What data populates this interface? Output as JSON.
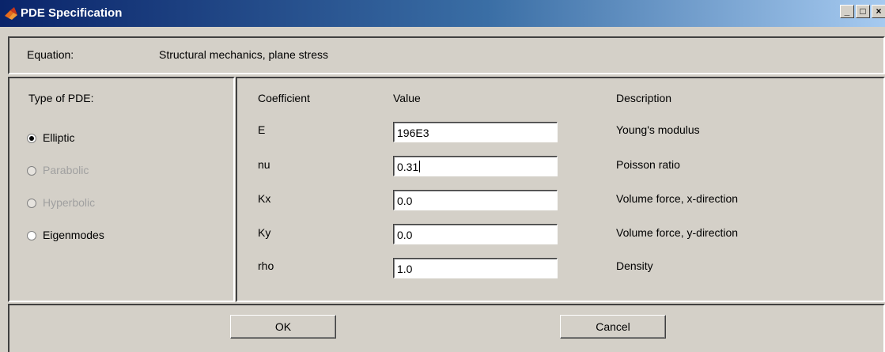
{
  "window": {
    "title": "PDE Specification",
    "minimize": "_",
    "maximize": "□",
    "close": "×"
  },
  "equation": {
    "label": "Equation:",
    "value": "Structural mechanics, plane stress"
  },
  "pde_type": {
    "heading": "Type of PDE:",
    "options": [
      {
        "label": "Elliptic",
        "selected": true,
        "enabled": true
      },
      {
        "label": "Parabolic",
        "selected": false,
        "enabled": false
      },
      {
        "label": "Hyperbolic",
        "selected": false,
        "enabled": false
      },
      {
        "label": "Eigenmodes",
        "selected": false,
        "enabled": true
      }
    ]
  },
  "coefficients": {
    "headers": {
      "coefficient": "Coefficient",
      "value": "Value",
      "description": "Description"
    },
    "rows": [
      {
        "name": "E",
        "value": "196E3",
        "description": "Young's modulus"
      },
      {
        "name": "nu",
        "value": "0.31",
        "description": "Poisson ratio"
      },
      {
        "name": "Kx",
        "value": "0.0",
        "description": "Volume force, x-direction"
      },
      {
        "name": "Ky",
        "value": "0.0",
        "description": "Volume force, y-direction"
      },
      {
        "name": "rho",
        "value": "1.0",
        "description": "Density"
      }
    ]
  },
  "buttons": {
    "ok": "OK",
    "cancel": "Cancel"
  }
}
